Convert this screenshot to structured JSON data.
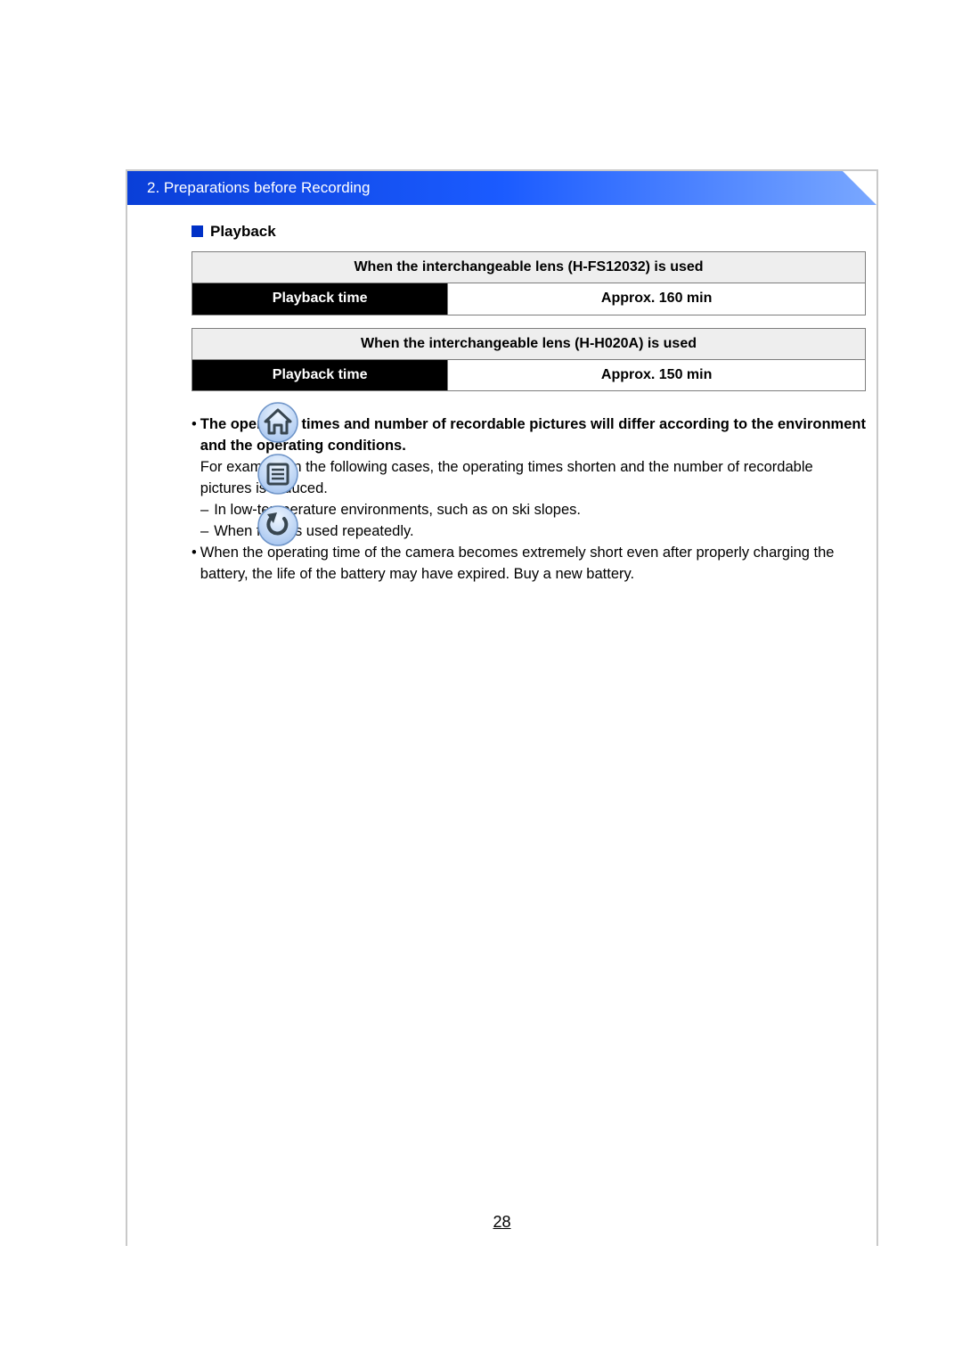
{
  "header": {
    "section_number": "2.",
    "section_title": "Preparations before Recording"
  },
  "icons": {
    "home": "home-icon",
    "toc": "toc-icon",
    "back": "back-icon"
  },
  "subsection": {
    "title": "Playback"
  },
  "tables": [
    {
      "caption": "When the interchangeable lens (H-FS12032) is used",
      "label": "Playback time",
      "value": "Approx. 160 min"
    },
    {
      "caption": "When the interchangeable lens (H-H020A) is used",
      "label": "Playback time",
      "value": "Approx. 150 min"
    }
  ],
  "notes": {
    "bold1": "The operating times and number of recordable pictures will differ according to the environment and the operating conditions.",
    "line2": "For example, in the following cases, the operating times shorten and the number of recordable pictures is reduced.",
    "dash1": "In low-temperature environments, such as on ski slopes.",
    "dash2": "When flash is used repeatedly.",
    "line3": "When the operating time of the camera becomes extremely short even after properly charging the battery, the life of the battery may have expired. Buy a new battery."
  },
  "page_number": "28"
}
